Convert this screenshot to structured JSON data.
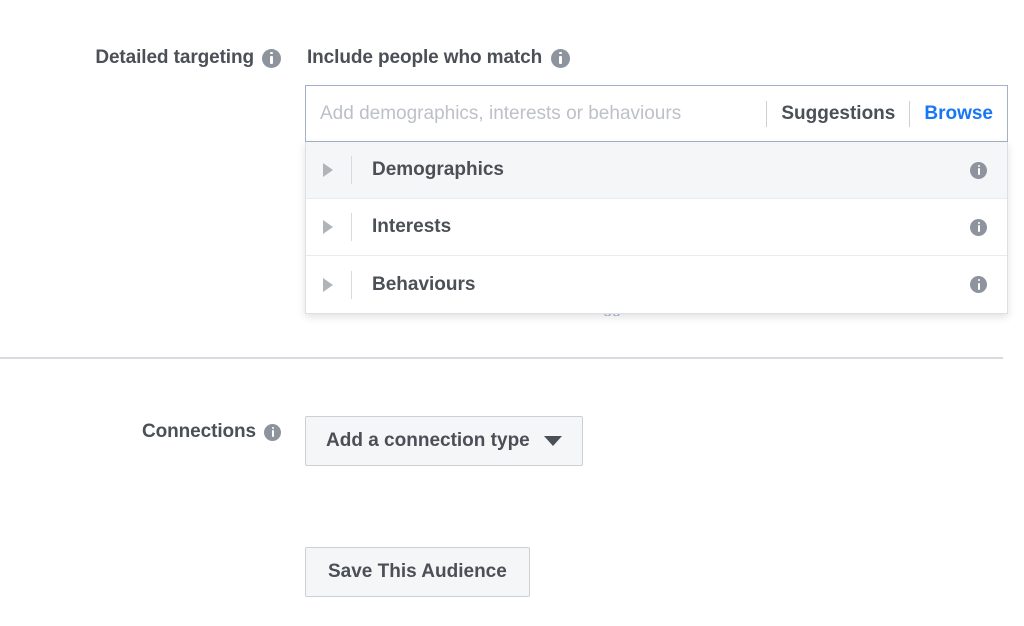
{
  "detailed_targeting": {
    "label": "Detailed targeting",
    "info_icon": "info-icon",
    "include_heading": "Include people who match",
    "include_info_icon": "info-icon"
  },
  "search": {
    "value": "",
    "placeholder": "Add demographics, interests or behaviours",
    "suggestions_label": "Suggestions",
    "browse_label": "Browse",
    "browse_color": "#1877f2"
  },
  "dropdown": {
    "rows": [
      {
        "label": "Demographics",
        "caret_icon": "caret-right-icon",
        "info_icon": "info-icon",
        "hovered": true
      },
      {
        "label": "Interests",
        "caret_icon": "caret-right-icon",
        "info_icon": "info-icon",
        "hovered": false
      },
      {
        "label": "Behaviours",
        "caret_icon": "caret-right-icon",
        "info_icon": "info-icon",
        "hovered": false
      }
    ],
    "obscured_text": "Suggestions   Browse"
  },
  "connections": {
    "label": "Connections",
    "info_icon": "info-icon",
    "button_label": "Add a connection type",
    "caret_icon": "caret-down-icon"
  },
  "save_audience": {
    "label": "Save This Audience"
  }
}
